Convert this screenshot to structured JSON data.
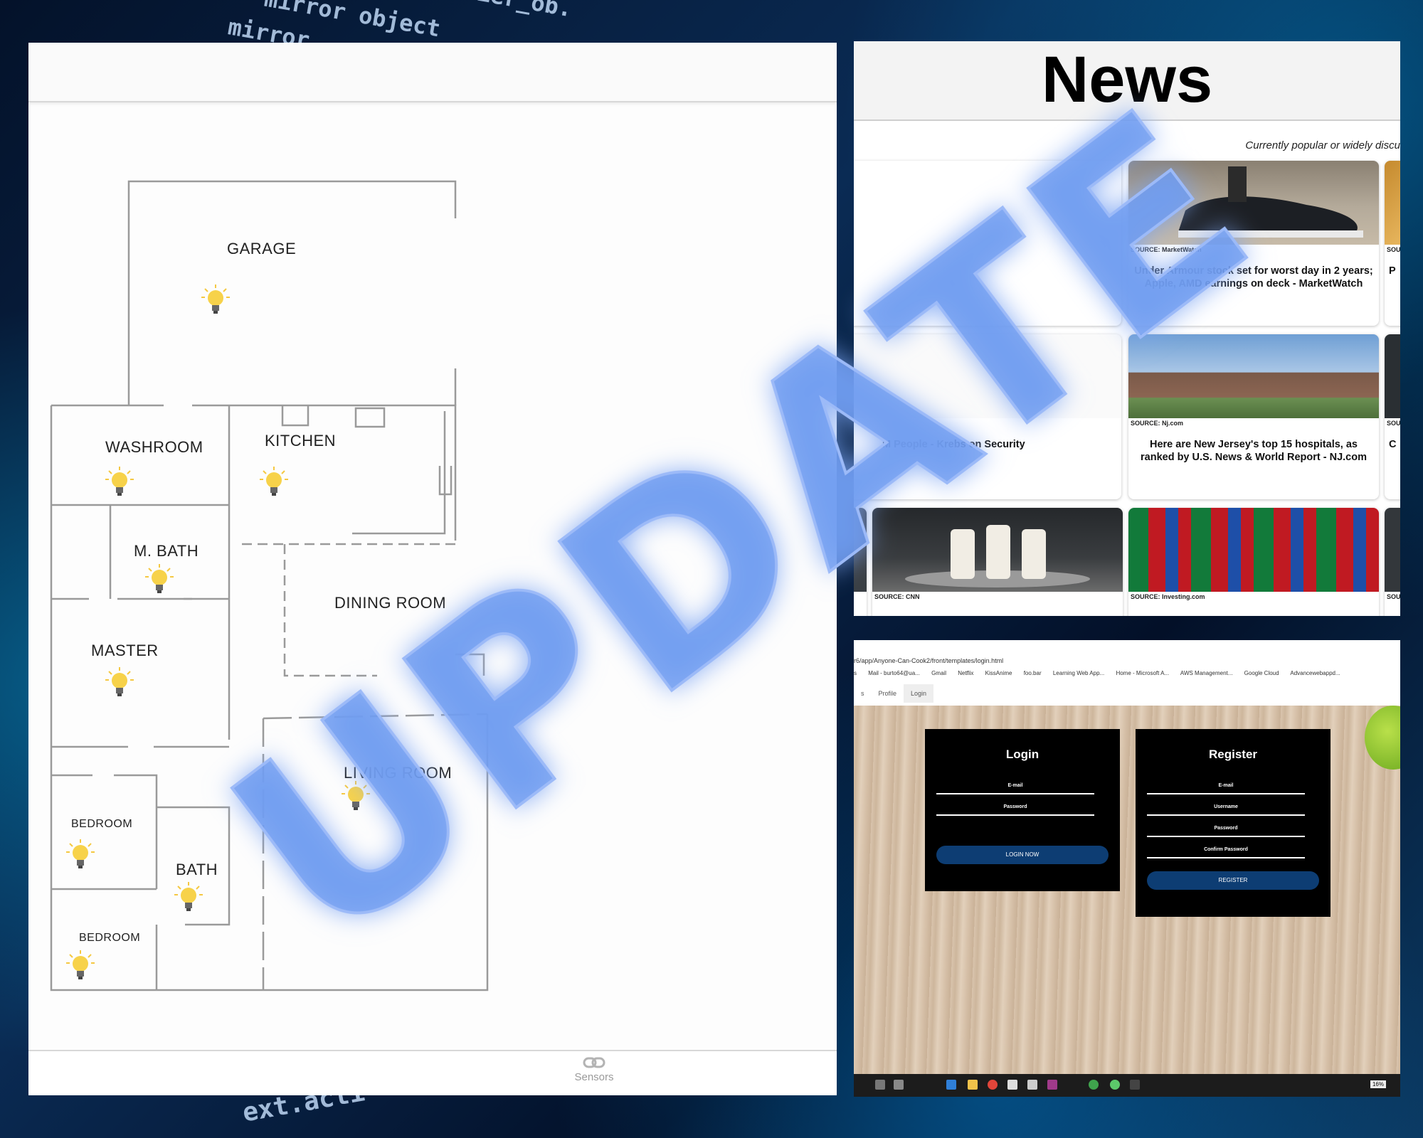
{
  "background": {
    "code_lines": [
      "mirror object",
      "mirror",
      "ier_ob.",
      "ext.acti"
    ]
  },
  "floor_plan": {
    "rooms": [
      {
        "label": "GARAGE"
      },
      {
        "label": "WASHROOM"
      },
      {
        "label": "KITCHEN"
      },
      {
        "label": "M. BATH"
      },
      {
        "label": "MASTER"
      },
      {
        "label": "DINING ROOM"
      },
      {
        "label": "LIVING ROOM"
      },
      {
        "label": "BEDROOM"
      },
      {
        "label": "BATH"
      },
      {
        "label": "BEDROOM"
      }
    ],
    "bottom_nav": {
      "label": "Sensors",
      "icon": "link-icon"
    }
  },
  "news": {
    "title": "News",
    "subtitle": "Currently popular or widely discu",
    "cards": [
      {
        "source": "",
        "title": ""
      },
      {
        "source": "SOURCE: MarketWatch",
        "title": "Under Armour stock set for worst day in 2 years; Apple, AMD earnings on deck - MarketWatch"
      },
      {
        "source": "SOU",
        "title": "P"
      },
      {
        "source": "",
        "title": "M People - Krebs on Security"
      },
      {
        "source": "SOURCE: Nj.com",
        "title": "Here are New Jersey's top 15 hospitals, as ranked by U.S. News & World Report - NJ.com"
      },
      {
        "source": "SOU",
        "title": "C"
      },
      {
        "source": "SOURCE: CNN",
        "title": ""
      },
      {
        "source": "SOURCE: Investing.com",
        "title": ""
      },
      {
        "source": "SOU",
        "title": ""
      }
    ]
  },
  "login_app": {
    "url": "r6/app/Anyone-Can-Cook2/front/templates/login.html",
    "bookmarks": [
      "s",
      "Mail - burto64@ua...",
      "Gmail",
      "Netflix",
      "KissAnime",
      "foo.bar",
      "Learning Web App...",
      "Home - Microsoft A...",
      "AWS Management...",
      "Google Cloud",
      "Advancewebappd..."
    ],
    "tabs": [
      "s",
      "Profile",
      "Login"
    ],
    "login": {
      "title": "Login",
      "fields": [
        "E-mail",
        "Password"
      ],
      "button": "LOGIN NOW"
    },
    "register": {
      "title": "Register",
      "fields": [
        "E-mail",
        "Username",
        "Password",
        "Confirm Password"
      ],
      "button": "REGISTER"
    },
    "taskbar_battery": "16%"
  },
  "overlay": {
    "text": "UPDATE",
    "color": "#6f9cf0"
  }
}
